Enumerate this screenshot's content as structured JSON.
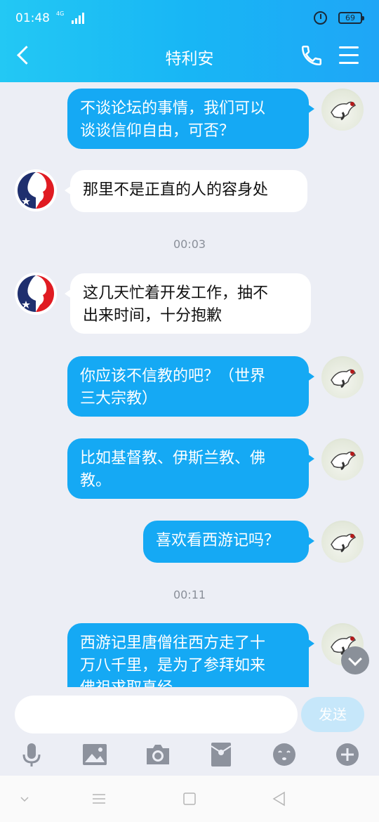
{
  "status_bar": {
    "time": "01:48",
    "network": "4G",
    "battery": "69"
  },
  "header": {
    "title": "特利安"
  },
  "messages": [
    {
      "side": "me",
      "lines": [
        "不谈论坛的事情，我们可以",
        "谈谈信仰自由，可否？"
      ]
    },
    {
      "side": "them",
      "lines": [
        "那里不是正直的人的容身处"
      ]
    },
    {
      "type": "timestamp",
      "text": "00:03"
    },
    {
      "side": "them",
      "lines": [
        "这几天忙着开发工作，抽不",
        "出来时间，十分抱歉"
      ]
    },
    {
      "side": "me",
      "lines": [
        "你应该不信教的吧？（世界",
        "三大宗教）"
      ]
    },
    {
      "side": "me",
      "lines": [
        "比如基督教、伊斯兰教、佛",
        "教。"
      ]
    },
    {
      "side": "me",
      "lines": [
        "喜欢看西游记吗？"
      ]
    },
    {
      "type": "timestamp",
      "text": "00:11"
    },
    {
      "side": "me",
      "lines": [
        "西游记里唐僧往西方走了十",
        "万八千里，是为了参拜如来",
        "佛祖求取真经"
      ]
    }
  ],
  "composer": {
    "input_value": "",
    "send_label": "发送"
  },
  "toolbar_icons": [
    "microphone-icon",
    "image-icon",
    "camera-icon",
    "red-packet-icon",
    "emoji-icon",
    "plus-icon"
  ],
  "colors": {
    "header": "#1fb3f5",
    "my_bubble": "#15a9f4",
    "their_bubble": "#ffffff",
    "background": "#eceef5",
    "send_button": "#c6e7fa"
  }
}
